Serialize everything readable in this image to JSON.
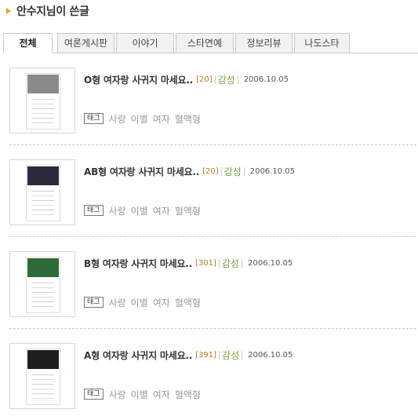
{
  "header": {
    "title": "안수지님이 쓴글"
  },
  "tabs": [
    {
      "label": "전체",
      "active": true
    },
    {
      "label": "여론게시판",
      "active": false
    },
    {
      "label": "이야기",
      "active": false
    },
    {
      "label": "스타연예",
      "active": false
    },
    {
      "label": "정보리뷰",
      "active": false
    },
    {
      "label": "나도스타",
      "active": false
    }
  ],
  "items": [
    {
      "title": "O형 여자랑 사귀지 마세요..",
      "count": "[20]",
      "category": "감성",
      "date": "2006.10.05",
      "tag_label": "태그",
      "tags": [
        "사랑",
        "이별",
        "여자",
        "혈액형"
      ],
      "photo_color": "#8a8a8a"
    },
    {
      "title": "AB형 여자랑 사귀지 마세요..",
      "count": "[20]",
      "category": "감성",
      "date": "2006.10.05",
      "tag_label": "태그",
      "tags": [
        "사랑",
        "이별",
        "여자",
        "혈액형"
      ],
      "photo_color": "#2a2a3a"
    },
    {
      "title": "B형 여자랑 사귀지 마세요..",
      "count": "[301]",
      "category": "감성",
      "date": "2006.10.05",
      "tag_label": "태그",
      "tags": [
        "사랑",
        "이별",
        "여자",
        "혈액형"
      ],
      "photo_color": "#2f6b3a"
    },
    {
      "title": "A형 여자랑 사귀지 마세요..",
      "count": "[391]",
      "category": "감성",
      "date": "2006.10.05",
      "tag_label": "태그",
      "tags": [
        "사랑",
        "이별",
        "여자",
        "혈액형"
      ],
      "photo_color": "#1e1e1e"
    }
  ],
  "colors": {
    "accent": "#e8a21a",
    "count": "#b87a1f",
    "category": "#79a33a"
  },
  "icons": {
    "header": "chevron-right-icon"
  }
}
